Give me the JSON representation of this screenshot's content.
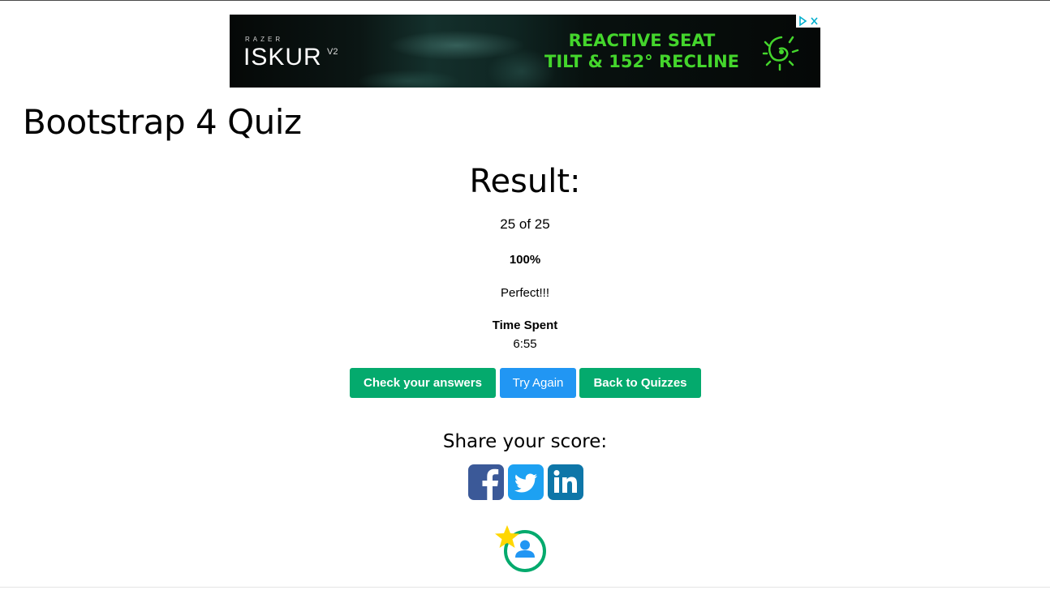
{
  "ad": {
    "brand_small": "RAZER",
    "brand_name": "ISKUR",
    "brand_version": "V2",
    "headline_line1": "REACTIVE SEAT",
    "headline_line2": "TILT & 152° RECLINE",
    "accent_color": "#44d62c"
  },
  "page": {
    "title": "Bootstrap 4 Quiz"
  },
  "result": {
    "heading": "Result:",
    "score": "25 of 25",
    "percent": "100%",
    "verdict": "Perfect!!!",
    "time_label": "Time Spent",
    "time_value": "6:55"
  },
  "buttons": {
    "check": "Check your answers",
    "try_again": "Try Again",
    "back": "Back to Quizzes"
  },
  "colors": {
    "green": "#04aa6d",
    "blue": "#2196f3",
    "facebook": "#3b5998",
    "twitter": "#1da1f2",
    "linkedin": "#0e76a8",
    "star": "#ffd700"
  },
  "share": {
    "label": "Share your score:",
    "icons": [
      "facebook-icon",
      "twitter-icon",
      "linkedin-icon"
    ]
  },
  "profile_icon": "profile-star-icon"
}
